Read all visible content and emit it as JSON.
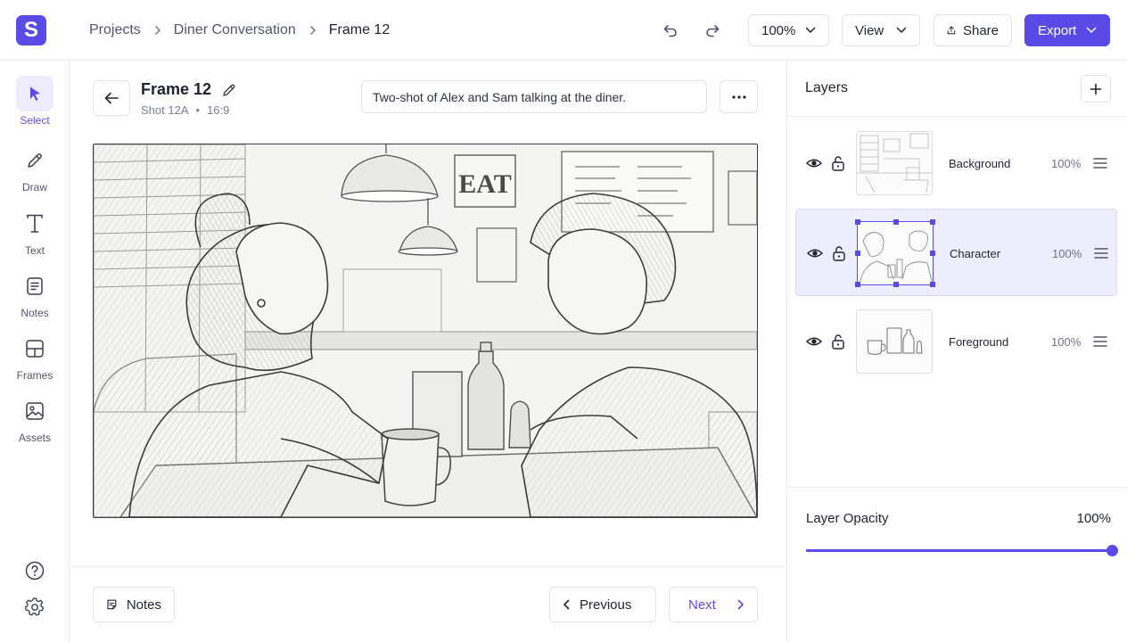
{
  "app": {
    "logo_letter": "S",
    "accent": "#5b4be6"
  },
  "breadcrumb": [
    "Projects",
    "Diner Conversation",
    "Frame 12"
  ],
  "toolbar": {
    "zoom": "100%",
    "view_label": "View",
    "share_label": "Share",
    "export_label": "Export"
  },
  "rail": {
    "tools": [
      {
        "label": "Select",
        "icon": "cursor-icon",
        "active": true
      },
      {
        "label": "Draw",
        "icon": "pencil-icon",
        "active": false
      },
      {
        "label": "Text",
        "icon": "text-icon",
        "active": false
      },
      {
        "label": "Notes",
        "icon": "notes-icon",
        "active": false
      },
      {
        "label": "Frames",
        "icon": "frames-icon",
        "active": false
      },
      {
        "label": "Assets",
        "icon": "image-icon",
        "active": false
      }
    ]
  },
  "frame": {
    "title": "Frame 12",
    "shot": "Shot 12A",
    "aspect": "16:9",
    "description": "Two-shot of Alex and Sam talking at the diner.",
    "sign_text": "EAT"
  },
  "footer": {
    "notes_label": "Notes",
    "previous_label": "Previous",
    "next_label": "Next"
  },
  "layers": {
    "title": "Layers",
    "items": [
      {
        "name": "Background",
        "opacity": "100%",
        "selected": false
      },
      {
        "name": "Character",
        "opacity": "100%",
        "selected": true
      },
      {
        "name": "Foreground",
        "opacity": "100%",
        "selected": false
      }
    ],
    "opacity_label": "Layer Opacity",
    "opacity_value": "100%",
    "opacity_fraction": 1.0
  }
}
